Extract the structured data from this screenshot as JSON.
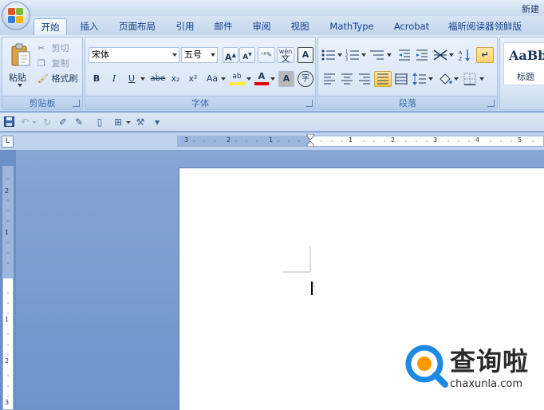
{
  "window": {
    "title": "新建 ",
    "office_button_icon": "office-logo-icon"
  },
  "tabs": [
    {
      "label": "开始",
      "active": true
    },
    {
      "label": "插入"
    },
    {
      "label": "页面布局"
    },
    {
      "label": "引用"
    },
    {
      "label": "邮件"
    },
    {
      "label": "审阅"
    },
    {
      "label": "视图"
    },
    {
      "label": "MathType"
    },
    {
      "label": "Acrobat"
    },
    {
      "label": "福昕阅读器领鲜版"
    }
  ],
  "clipboard": {
    "paste_label": "粘贴",
    "cut_label": "剪切",
    "copy_label": "复制",
    "format_painter_label": "格式刷",
    "group_label": "剪贴板"
  },
  "font": {
    "font_name": "宋体",
    "font_size": "五号",
    "group_label": "字体",
    "bold": "B",
    "italic": "I",
    "underline": "U",
    "strikethrough": "abe",
    "subscript": "x₂",
    "superscript": "x²",
    "change_case": "Aa",
    "grow_font": "A",
    "shrink_font": "A",
    "phonetic": "wén",
    "char_border": "A",
    "char_shading": "A",
    "enclose_char": "字",
    "highlight": "ab",
    "font_color": "A"
  },
  "paragraph": {
    "group_label": "段落"
  },
  "styles": {
    "style_preview": "AaBb",
    "style_name": "标题"
  },
  "watermark": {
    "text_cn": "查询啦",
    "text_url": "chaxunla.com"
  },
  "hruler_numbers": [
    "3",
    "2",
    "1",
    "1",
    "2",
    "3",
    "4",
    "5"
  ],
  "vruler_numbers": [
    "2",
    "1",
    "1",
    "2",
    "3"
  ],
  "colors": {
    "accent": "#15428b",
    "highlight_yellow": "#ffeb3b",
    "font_red": "#e00000",
    "watermark_blue": "#1e88e5",
    "watermark_orange": "#ff9800"
  }
}
